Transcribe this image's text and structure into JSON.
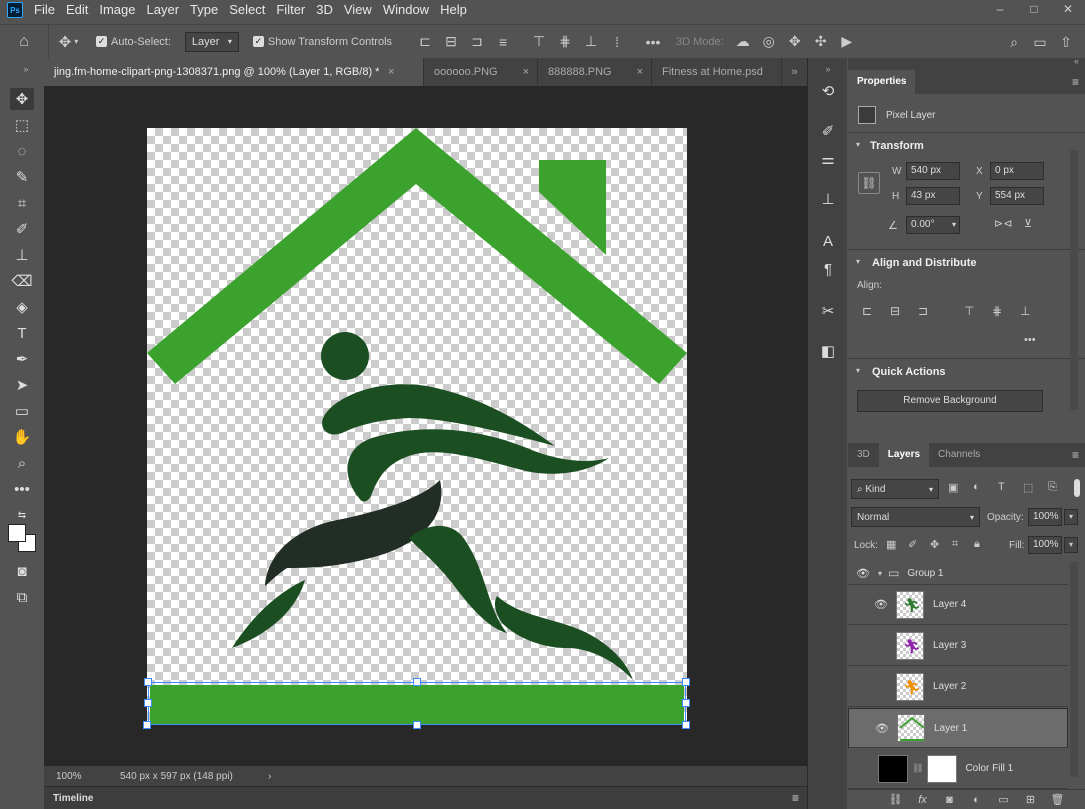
{
  "app": {
    "logo": "Ps"
  },
  "menu": [
    "File",
    "Edit",
    "Image",
    "Layer",
    "Type",
    "Select",
    "Filter",
    "3D",
    "View",
    "Window",
    "Help"
  ],
  "window_controls": {
    "minimize": "–",
    "maximize": "□",
    "close": "✕"
  },
  "options": {
    "auto_select_label": "Auto-Select:",
    "auto_select_value": "Layer",
    "transform_label": "Show Transform Controls",
    "mode_3d_label": "3D Mode:"
  },
  "tabs": [
    {
      "label": "jing.fm-home-clipart-png-1308371.png @ 100% (Layer 1, RGB/8) *",
      "close": "×",
      "active": true
    },
    {
      "label": "oooooo.PNG",
      "close": "×",
      "active": false
    },
    {
      "label": "888888.PNG",
      "close": "×",
      "active": false
    },
    {
      "label": "Fitness at Home.psd",
      "close": "",
      "active": false
    }
  ],
  "status": {
    "zoom": "100%",
    "doc_info": "540 px x 597 px (148 ppi)",
    "arrow": "›"
  },
  "timeline": {
    "label": "Timeline"
  },
  "properties": {
    "tab": "Properties",
    "pixel_layer": "Pixel Layer",
    "transform_header": "Transform",
    "w_label": "W",
    "w_value": "540 px",
    "x_label": "X",
    "x_value": "0 px",
    "h_label": "H",
    "h_value": "43 px",
    "y_label": "Y",
    "y_value": "554 px",
    "angle_value": "0.00°",
    "align_header": "Align and Distribute",
    "align_label": "Align:",
    "quick_header": "Quick Actions",
    "remove_bg": "Remove Background"
  },
  "layers_panel": {
    "tabs": [
      "3D",
      "Layers",
      "Channels"
    ],
    "kind_label": "Kind",
    "blend_mode": "Normal",
    "opacity_label": "Opacity:",
    "opacity_value": "100%",
    "lock_label": "Lock:",
    "fill_label": "Fill:",
    "fill_value": "100%",
    "group_name": "Group 1",
    "layers": [
      {
        "name": "Layer 4",
        "visible": true,
        "color": "#2e7d32"
      },
      {
        "name": "Layer 3",
        "visible": false,
        "color": "#8e24aa"
      },
      {
        "name": "Layer 2",
        "visible": false,
        "color": "#ef8f00"
      },
      {
        "name": "Layer 1",
        "visible": true,
        "color": "#3ca22e"
      }
    ],
    "fill_layer_name": "Color Fill 1"
  },
  "colors": {
    "light_green": "#3ca22e",
    "dark_green": "#1b4f22",
    "selection": "#3d8bff"
  }
}
